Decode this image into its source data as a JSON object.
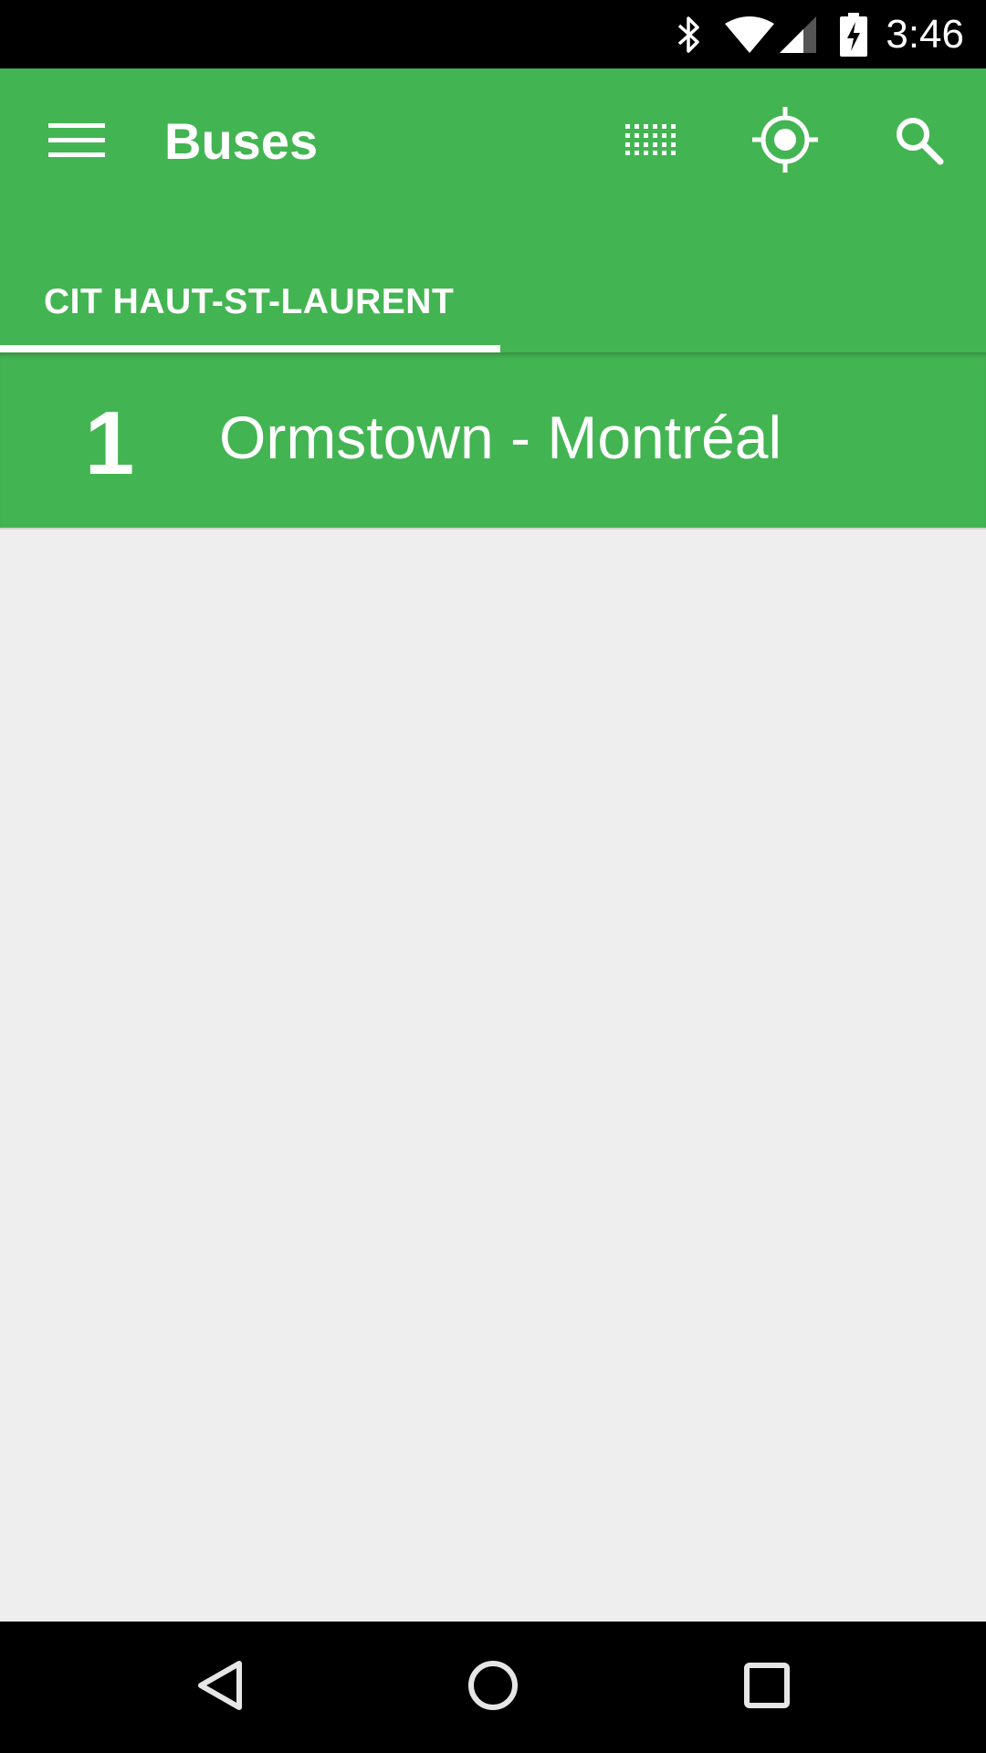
{
  "status_bar": {
    "time": "3:46",
    "icons": [
      "bluetooth-icon",
      "wifi-icon",
      "signal-icon",
      "battery-charging-icon"
    ]
  },
  "app_bar": {
    "title": "Buses",
    "actions": [
      "menu-icon",
      "grid-view-icon",
      "my-location-icon",
      "search-icon"
    ]
  },
  "tabs": [
    {
      "label": "CIT HAUT-ST-LAURENT",
      "selected": true
    }
  ],
  "routes": [
    {
      "number": "1",
      "name": "Ormstown - Montréal"
    }
  ],
  "nav_bar": {
    "buttons": [
      "back-icon",
      "home-icon",
      "recents-icon"
    ]
  },
  "colors": {
    "primary": "#43b452",
    "background": "#eeeeee",
    "system_bars": "#000000"
  }
}
